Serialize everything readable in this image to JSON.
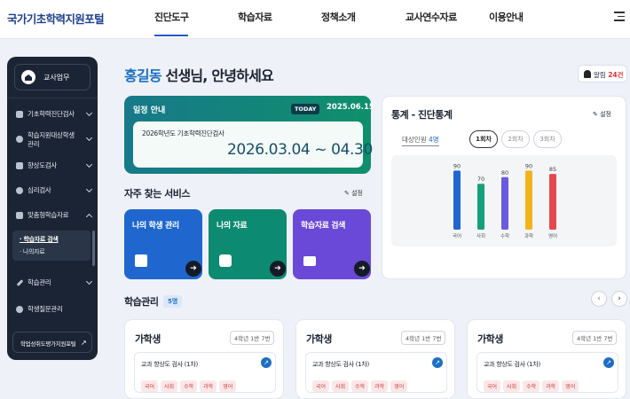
{
  "header": {
    "logo": "국가기초학력지원포털",
    "nav": [
      "진단도구",
      "학습자료",
      "정책소개",
      "교사연수자료",
      "이용안내"
    ],
    "active_nav": "진단도구"
  },
  "sidebar": {
    "top_label": "교사업무",
    "items": [
      {
        "label": "기초학력진단검사",
        "icon": "document-icon"
      },
      {
        "label": "학습지원대상학생",
        "label2": "관리",
        "icon": "student-icon"
      },
      {
        "label": "향상도검사",
        "icon": "chart-icon"
      },
      {
        "label": "심리검사",
        "icon": "heart-icon"
      },
      {
        "label": "맞춤형학습자료",
        "icon": "folder-icon"
      },
      {
        "label": "학습관리",
        "icon": "pencil-icon"
      },
      {
        "label": "학생질문관리",
        "icon": "question-icon"
      }
    ],
    "sub_items": [
      "학습자료 검색",
      "나의자료"
    ],
    "bottom_button": "학업성취도평가지원포털"
  },
  "greeting": {
    "name": "홍길동",
    "rest": " 선생님, 안녕하세요"
  },
  "alarm": {
    "label": "알림",
    "count": "24건"
  },
  "schedule": {
    "title": "일정 안내",
    "today_badge": "TODAY",
    "today_date": "2025.06.15",
    "event_title": "2026학년도 기초학력진단검사",
    "event_range": "2026.03.04 ~ 04.30"
  },
  "services": {
    "title": "자주 찾는 서비스",
    "setting": "설정",
    "items": [
      {
        "label": "나의 학생 관리",
        "color": "#1f67cf"
      },
      {
        "label": "나의 자료",
        "color": "#0d8a72"
      },
      {
        "label": "학습자료 검색",
        "color": "#6a49d8"
      }
    ]
  },
  "stats": {
    "title": "통계 - 진단통계",
    "setting": "설정",
    "target_label": "대상인원",
    "target_count": "4명",
    "rounds": [
      "1회차",
      "2회차",
      "3회차"
    ],
    "active_round": "1회차"
  },
  "chart_data": {
    "type": "bar",
    "categories": [
      "국어",
      "사회",
      "수학",
      "과학",
      "영어"
    ],
    "values": [
      90,
      70,
      80,
      90,
      85
    ],
    "colors": [
      "#1f67cf",
      "#16a079",
      "#6a5ae0",
      "#f2b31b",
      "#e5484d"
    ],
    "ylim": [
      0,
      100
    ]
  },
  "management": {
    "title": "학습관리",
    "count": "5명",
    "cards": [
      {
        "name": "가학생",
        "class": "4학년 1반 7번",
        "test": "교과 향상도 검사 (1차)",
        "subjects": [
          "국어",
          "사회",
          "수학",
          "과학",
          "영어"
        ]
      },
      {
        "name": "가학생",
        "class": "4학년 1반 7번",
        "test": "교과 향상도 검사 (1차)",
        "subjects": [
          "국어",
          "사회",
          "수학",
          "과학",
          "영어"
        ]
      },
      {
        "name": "가학생",
        "class": "4학년 1반 7번",
        "test": "교과 향상도 검사 (1차)",
        "subjects": [
          "국어",
          "사회",
          "수학",
          "과학",
          "영어"
        ]
      }
    ]
  }
}
